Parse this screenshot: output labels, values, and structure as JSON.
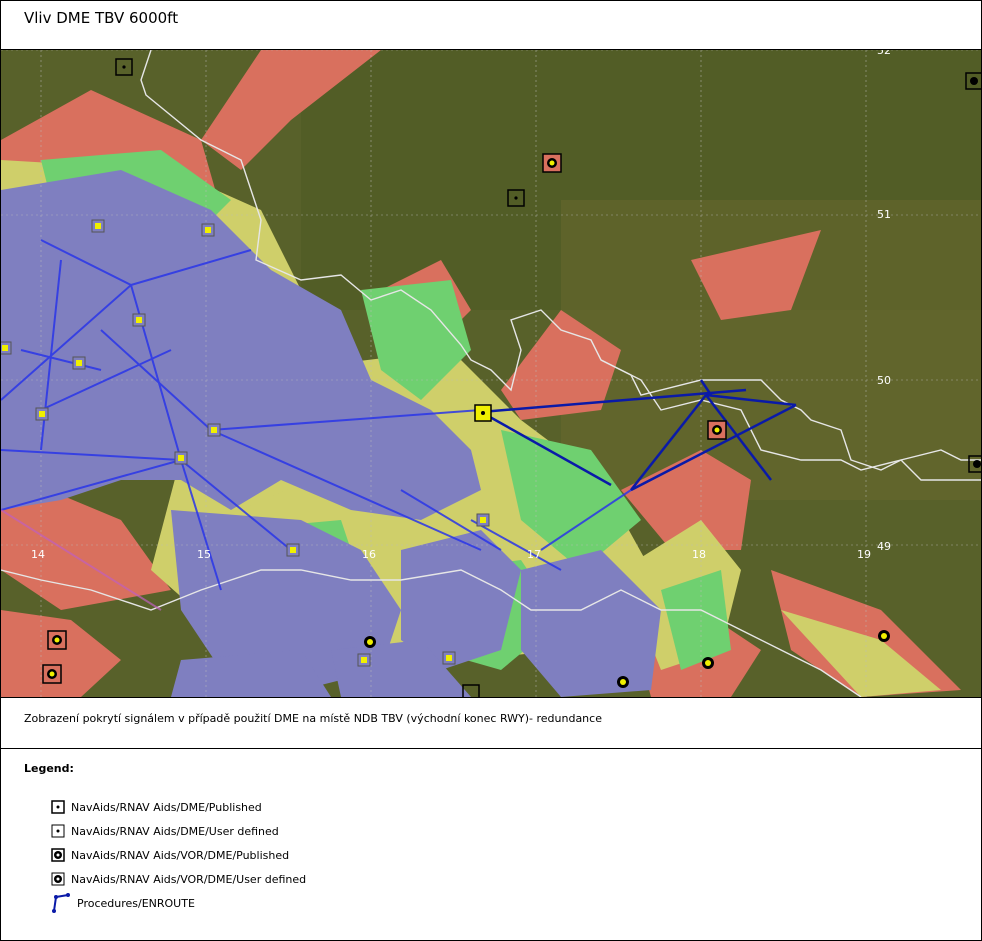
{
  "title": "Vliv DME TBV 6000ft",
  "caption": "Zobrazení pokrytí signálem v případě použití DME na místě NDB TBV (východní konec RWY)- redundance",
  "legend": {
    "title": "Legend:",
    "items": [
      {
        "label": "NavAids/RNAV Aids/DME/Published",
        "icon": "dme-published-icon"
      },
      {
        "label": "NavAids/RNAV Aids/DME/User defined",
        "icon": "dme-user-defined-icon"
      },
      {
        "label": "NavAids/RNAV Aids/VOR/DME/Published",
        "icon": "vor-dme-published-icon"
      },
      {
        "label": "NavAids/RNAV Aids/VOR/DME/User defined",
        "icon": "vor-dme-user-defined-icon"
      },
      {
        "label": "Procedures/ENROUTE",
        "icon": "enroute-procedure-icon"
      }
    ]
  },
  "map": {
    "longitude_labels": [
      "14",
      "15",
      "16",
      "17",
      "18",
      "19"
    ],
    "latitude_labels": [
      "52",
      "51",
      "50",
      "49"
    ],
    "colors": {
      "terrain": "#58612a",
      "coverage_blue": "#7f7fc0",
      "coverage_green": "#6fd070",
      "coverage_yellow": "#cfcf6a",
      "coverage_red": "#d9705e",
      "route_blue": "#2a36e8",
      "route_dark": "#0a1aa8",
      "border": "#e6e6e6"
    }
  }
}
